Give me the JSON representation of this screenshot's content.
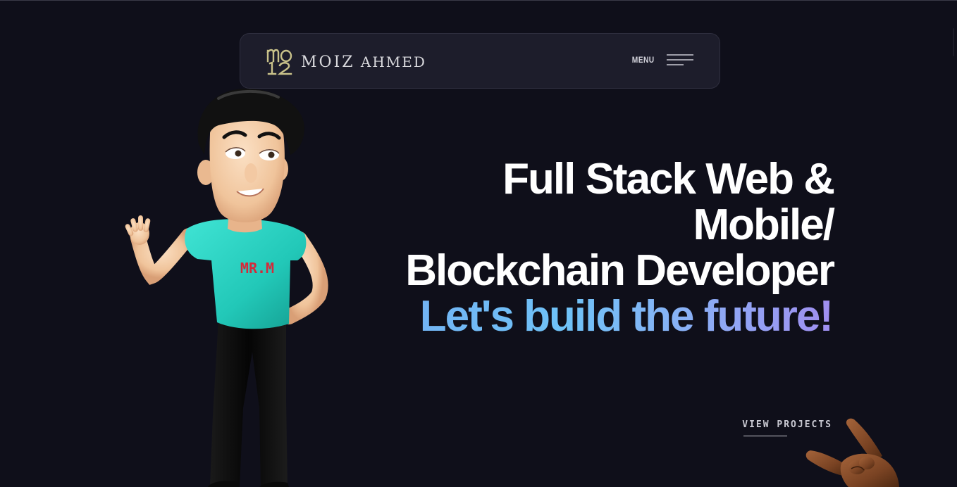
{
  "header": {
    "logo_mark": "MO 12",
    "brand_first": "MOIZ",
    "brand_last": "AHMED",
    "menu_label": "MENU"
  },
  "hero": {
    "line1": "Full Stack Web &",
    "line2": "Mobile/",
    "line3": "Blockchain Developer",
    "tagline": "Let's build the future!"
  },
  "cta": {
    "view_projects": "VIEW PROJECTS"
  },
  "avatar": {
    "shirt_text": "MR.M"
  },
  "colors": {
    "background": "#0f0f1a",
    "navbar": "#1d1d2b",
    "logo_gold": "#c9c28a",
    "gradient_start": "#72b4f4",
    "gradient_end": "#a08ef0",
    "shirt": "#2ed6c6",
    "shirt_text": "#d42a3a"
  },
  "icons": [
    "logo-icon",
    "hamburger-icon",
    "avatar-image",
    "hand-emoji"
  ]
}
